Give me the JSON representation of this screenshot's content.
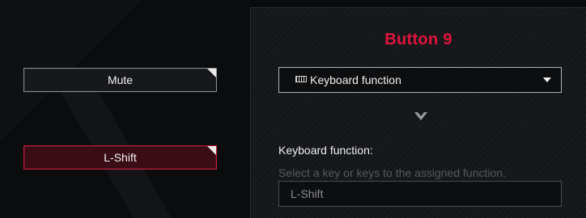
{
  "buttons": {
    "mute": {
      "label": "Mute"
    },
    "lshift": {
      "label": "L-Shift",
      "selected": true
    }
  },
  "panel": {
    "title": "Button 9",
    "dropdown": {
      "icon": "keyboard-icon",
      "selected": "Keyboard function"
    },
    "function_label": "Keyboard function:",
    "hint": "Select a key or keys to the assigned function.",
    "key_value": "L-Shift"
  },
  "colors": {
    "accent": "#e0143c",
    "selected_border": "#c61a3a",
    "background": "#0a0b0d"
  }
}
